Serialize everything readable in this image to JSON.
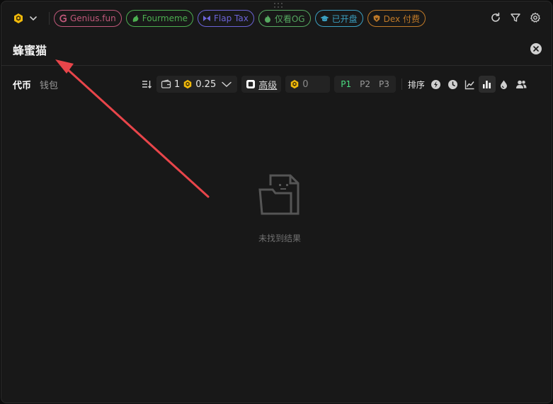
{
  "platforms": [
    {
      "label": "Genius.fun",
      "icon": "genius-logo-icon",
      "color": "#c0587a"
    },
    {
      "label": "Fourmeme",
      "icon": "fourmeme-logo-icon",
      "color": "#4caf50"
    },
    {
      "label": "Flap Tax",
      "icon": "flap-logo-icon",
      "color": "#6b63d6"
    },
    {
      "label": "仅看OG",
      "icon": "flame-icon",
      "color": "#55a860"
    },
    {
      "label": "已开盘",
      "icon": "graduation-cap-icon",
      "color": "#3ba0c2"
    },
    {
      "label": "Dex 付费",
      "icon": "dex-shield-icon",
      "color": "#c07a28"
    }
  ],
  "search": {
    "value": "蜂蜜猫"
  },
  "tabs": {
    "tokens": "代币",
    "wallets": "钱包"
  },
  "toolbar": {
    "wallet_count": "1",
    "amount": "0.25",
    "advanced_label": "高级",
    "gas_value": "0",
    "presets": [
      "P1",
      "P2",
      "P3"
    ],
    "sort_label": "排序"
  },
  "empty": {
    "message": "未找到结果"
  },
  "colors": {
    "accent_green": "#4ade80",
    "bnb_yellow": "#f0b90b",
    "arrow_red": "#e8454a"
  }
}
